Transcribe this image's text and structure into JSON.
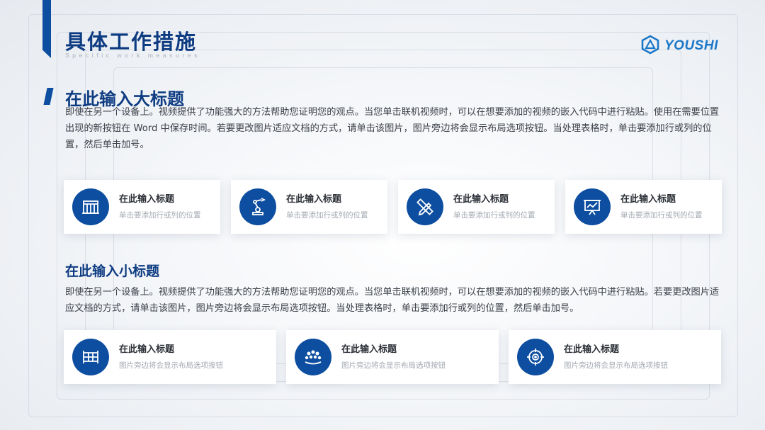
{
  "header": {
    "title": "具体工作措施",
    "subtitle": "Specific work measures",
    "logo_text": "YOUSHI"
  },
  "section": {
    "title": "在此输入大标题",
    "paragraph": "即使在另一个设备上。视频提供了功能强大的方法帮助您证明您的观点。当您单击联机视频时，可以在想要添加的视频的嵌入代码中进行粘贴。使用在需要位置出现的新按钮在 Word 中保存时间。若要更改图片适应文档的方式，请单击该图片，图片旁边将会显示布局选项按钮。当处理表格时，单击要添加行或列的位置，然后单击加号。",
    "cards": [
      {
        "icon": "building-icon",
        "title": "在此输入标题",
        "desc": "单击要添加行或列的位置"
      },
      {
        "icon": "robot-arm-icon",
        "title": "在此输入标题",
        "desc": "单击要添加行或列的位置"
      },
      {
        "icon": "pencil-ruler-icon",
        "title": "在此输入标题",
        "desc": "单击要添加行或列的位置"
      },
      {
        "icon": "presentation-chart-icon",
        "title": "在此输入标题",
        "desc": "单击要添加行或列的位置"
      }
    ]
  },
  "subsection": {
    "title": "在此输入小标题",
    "paragraph": "即使在另一个设备上。视频提供了功能强大的方法帮助您证明您的观点。当您单击联机视频时，可以在想要添加的视频的嵌入代码中进行粘贴。若要更改图片适应文档的方式，请单击该图片，图片旁边将会显示布局选项按钮。当处理表格时，单击要添加行或列的位置，然后单击加号。",
    "cards": [
      {
        "icon": "structure-icon",
        "title": "在此输入标题",
        "desc": "图片旁边将会显示布局选项按钮"
      },
      {
        "icon": "team-icon",
        "title": "在此输入标题",
        "desc": "图片旁边将会显示布局选项按钮"
      },
      {
        "icon": "target-icon",
        "title": "在此输入标题",
        "desc": "图片旁边将会显示布局选项按钮"
      }
    ]
  },
  "colors": {
    "primary": "#0e4ea0",
    "title": "#0e3c82",
    "logo": "#1b77c8"
  }
}
